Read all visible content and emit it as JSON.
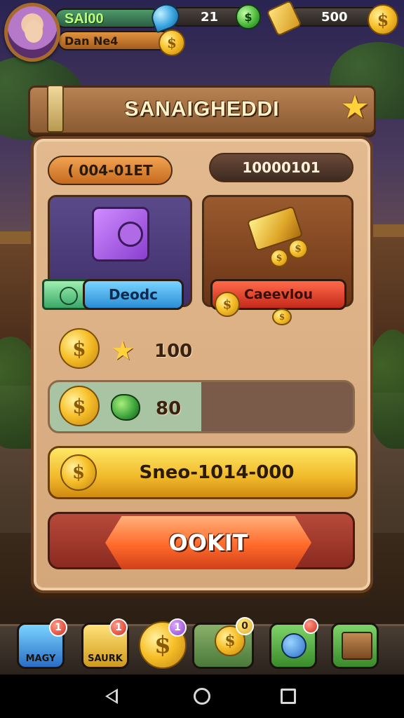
{
  "hud": {
    "player_name": "SAl00",
    "player_subtitle": "Dan Ne4",
    "gem_count": "21",
    "gold_count": "500",
    "coin_symbol": "$"
  },
  "dialog": {
    "title": "SANAIGHEDDI",
    "left_pill": "( 004-01ET",
    "right_pill": "10000101",
    "deposit_label": "Deodc",
    "collect_label": "Caeevlou",
    "row1_value": "100",
    "row2_value": "80",
    "gold_button_label": "Sneo-1014-000",
    "confirm_label": "OOKIT"
  },
  "tabs": [
    {
      "label": "MAGY",
      "badge": "1"
    },
    {
      "label": "SAURK",
      "badge": "1"
    },
    {
      "label": "",
      "badge": "1"
    },
    {
      "label": "",
      "badge": "0"
    },
    {
      "label": "",
      "badge": ""
    },
    {
      "label": "",
      "badge": ""
    }
  ],
  "colors": {
    "panel": "#d4a77a",
    "banner": "#8a5a32",
    "gold": "#f0b82a",
    "confirm": "#ff6a2a",
    "deposit": "#2a8ed6",
    "collect": "#c42a1a"
  },
  "icons": {
    "close": "star-icon",
    "gem": "blue-gem-icon",
    "currency": "gold-coin-icon"
  }
}
